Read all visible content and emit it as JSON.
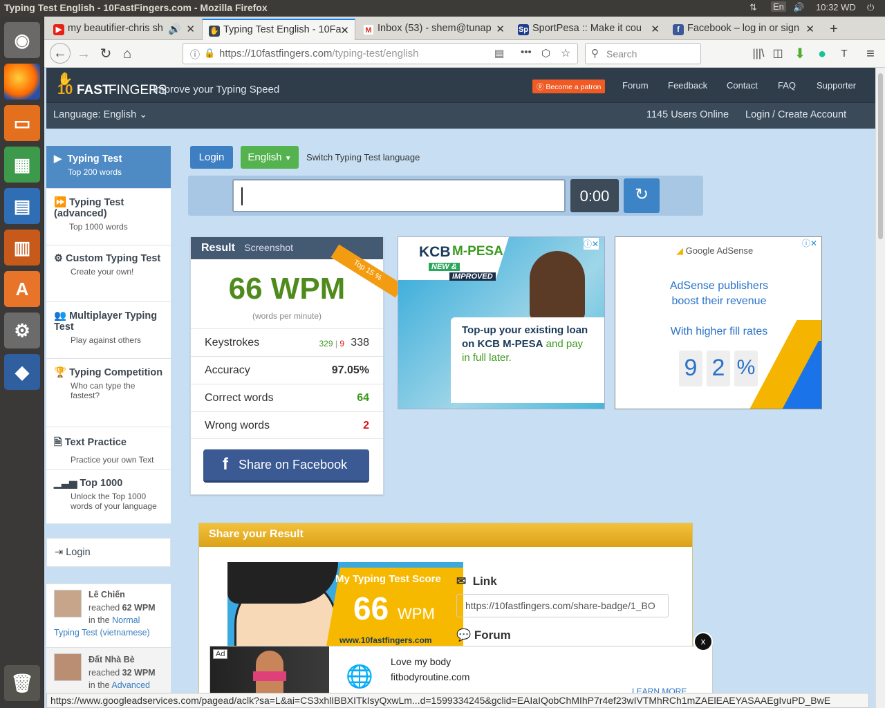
{
  "os": {
    "window_title": "Typing Test English - 10FastFingers.com - Mozilla Firefox",
    "lang_indicator": "En",
    "clock": "10:32 WD"
  },
  "browser": {
    "tabs": [
      {
        "label": "my beautifier-chris sh",
        "favicon": "youtube-icon"
      },
      {
        "label": "Typing Test English - 10Fa",
        "favicon": "10fastfingers-icon"
      },
      {
        "label": "Inbox (53) - shem@tunap",
        "favicon": "gmail-icon"
      },
      {
        "label": "SportPesa :: Make it cou",
        "favicon": "sportpesa-icon"
      },
      {
        "label": "Facebook – log in or sign",
        "favicon": "facebook-icon"
      }
    ],
    "url_host": "https://10fastfingers.com",
    "url_path": "/typing-test/english",
    "search_placeholder": "Search",
    "status_url": "https://www.googleadservices.com/pagead/aclk?sa=L&ai=CS3xhlIBBXITkIsyQxwLm...d=1599334245&gclid=EAIaIQobChMIhP7r4ef23wIVTMhRCh1mZAElEAEYASAAEgIvuPD_BwE"
  },
  "site": {
    "logo_a": "10",
    "logo_b": "FAST",
    "logo_c": "FINGERS",
    "tagline": "Improve your Typing Speed",
    "patron": "Become a patron",
    "nav": [
      "Forum",
      "Feedback",
      "Contact",
      "FAQ",
      "Supporter"
    ],
    "language_label": "Language: English",
    "users_online": "1145 Users Online",
    "login": "Login",
    "separator": "/",
    "create_account": "Create Account"
  },
  "sidebar": {
    "items": [
      {
        "title": "Typing Test",
        "sub": "Top 200 words"
      },
      {
        "title": "Typing Test (advanced)",
        "sub": "Top 1000 words"
      },
      {
        "title": "Custom Typing Test",
        "sub": "Create your own!"
      },
      {
        "title": "Multiplayer Typing Test",
        "sub": "Play against others"
      },
      {
        "title": "Typing Competition",
        "sub": "Who can type the fastest?"
      },
      {
        "title": "Text Practice",
        "sub": "Practice your own Text"
      },
      {
        "title": "Top 1000",
        "sub": "Unlock the Top 1000 words of your language"
      }
    ],
    "login": "Login",
    "activity": [
      {
        "name": "Lê Chiến",
        "reached": "reached",
        "wpm": "62 WPM",
        "in_the": "in the",
        "mode": "Normal",
        "test": "Typing Test (vietnamese)"
      },
      {
        "name": "Đất Nhà Bè",
        "reached": "reached",
        "wpm": "32 WPM",
        "in_the": "in the",
        "mode": "Advanced",
        "test": ""
      }
    ]
  },
  "controls": {
    "login_btn": "Login",
    "language_btn": "English",
    "switch_label": "Switch Typing Test language",
    "timer": "0:00"
  },
  "result": {
    "title": "Result",
    "screenshot": "Screenshot",
    "ribbon": "Top 15 %",
    "wpm": "66 WPM",
    "wpm_caption": "(words per minute)",
    "rows": [
      {
        "label": "Keystrokes",
        "correct": "329",
        "sep": "|",
        "wrong": "9",
        "value": "338"
      },
      {
        "label": "Accuracy",
        "value": "97.05%"
      },
      {
        "label": "Correct words",
        "value": "64"
      },
      {
        "label": "Wrong words",
        "value": "2"
      }
    ],
    "share_fb": "Share on Facebook"
  },
  "ads": {
    "kcb_brand": "KCB",
    "kcb_mpesa": "M-PESA",
    "kcb_new": "NEW &",
    "kcb_improved": "IMPROVED",
    "kcb_line1": "Top-up your existing loan",
    "kcb_line2": "on KCB M-PESA",
    "kcb_line3": "and pay",
    "kcb_line4": "in full later.",
    "adsense_brand": "Google AdSense",
    "adsense_line1": "AdSense publishers",
    "adsense_line2": "boost their revenue",
    "adsense_line3": "With higher fill rates",
    "adsense_digits": [
      "9",
      "2",
      "%"
    ],
    "bottom_badge": "Ad",
    "bottom_title": "Love my body",
    "bottom_domain": "fitbodyroutine.com",
    "bottom_cta": "LEARN MORE",
    "close": "x"
  },
  "share": {
    "title": "Share your Result",
    "badge_title": "My Typing Test Score",
    "badge_score": "66",
    "badge_unit": "WPM",
    "badge_site": "www.10fastfingers.com",
    "link_label": "Link",
    "link_value": "https://10fastfingers.com/share-badge/1_BO",
    "forum_label": "Forum"
  },
  "colors": {
    "accent_blue": "#4e8ac4",
    "header_dark": "#2f3d4a",
    "wpm_green": "#4f8a1c",
    "correct_green": "#3c9a1f",
    "wrong_red": "#d9161c",
    "share_gold": "#e5ac22",
    "facebook_blue": "#3b5a94"
  }
}
